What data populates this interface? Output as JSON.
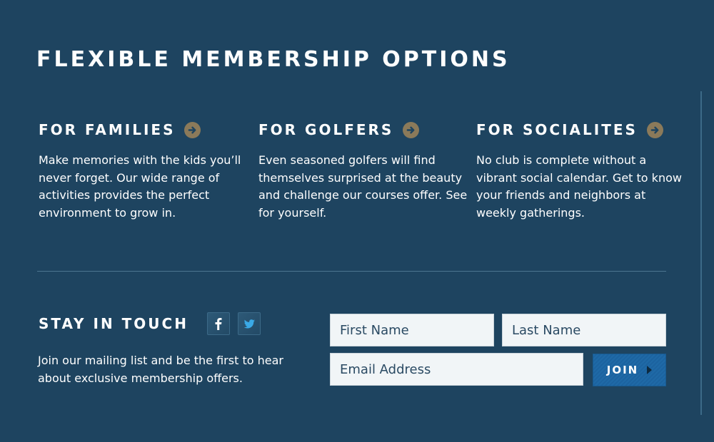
{
  "header": {
    "title": "FLEXIBLE MEMBERSHIP OPTIONS"
  },
  "options": [
    {
      "heading": "FOR FAMILIES",
      "text": "Make memories with the kids you’ll never forget. Our wide range of activities provides the perfect environment to grow in.",
      "icon": "arrow-right-icon"
    },
    {
      "heading": "FOR GOLFERS",
      "text": "Even seasoned golfers will find themselves surprised at the beauty and challenge our courses offer. See for yourself.",
      "icon": "arrow-right-icon"
    },
    {
      "heading": "FOR SOCIALITES",
      "text": "No club is complete without a vibrant social calendar. Get to know your friends and neighbors at weekly gatherings.",
      "icon": "arrow-right-icon"
    }
  ],
  "stay_in_touch": {
    "heading": "STAY IN TOUCH",
    "text": "Join our mailing list and be the first to hear about exclusive membership offers.",
    "social": [
      "facebook-icon",
      "twitter-icon"
    ]
  },
  "form": {
    "first_name_placeholder": "First Name",
    "last_name_placeholder": "Last Name",
    "email_placeholder": "Email Address",
    "join_label": "JOIN"
  },
  "colors": {
    "background": "#1e4460",
    "accent_circle": "#8b7a5a",
    "join_button": "#1f6aa7"
  }
}
